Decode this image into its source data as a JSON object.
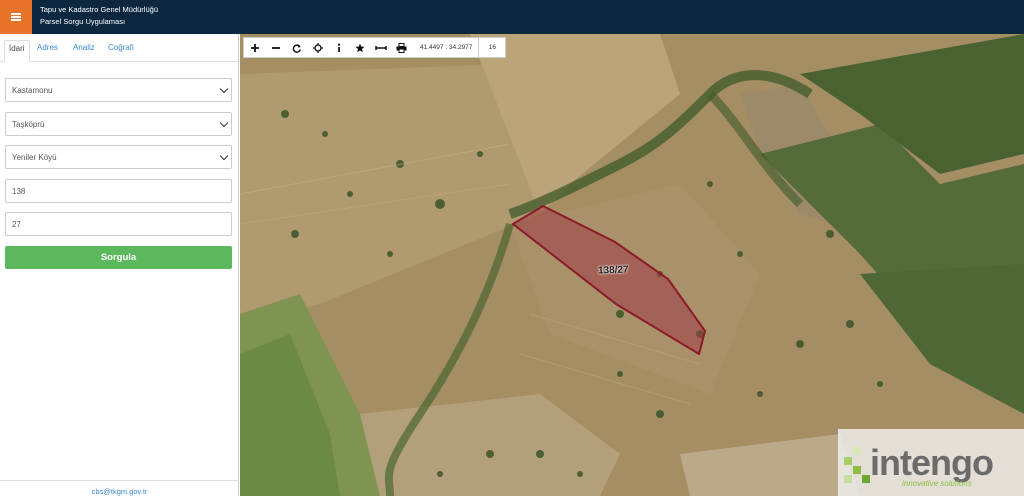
{
  "header": {
    "title_line1": "Tapu ve Kadastro Genel Müdürlüğü",
    "title_line2": "Parsel Sorgu Uygulaması"
  },
  "sidebar": {
    "tabs": [
      {
        "label": "İdari",
        "active": true
      },
      {
        "label": "Adres",
        "active": false
      },
      {
        "label": "Analiz",
        "active": false
      },
      {
        "label": "Coğrafi",
        "active": false
      }
    ],
    "province": "Kastamonu",
    "district": "Taşköprü",
    "neighborhood": "Yeniler Köyü",
    "block_no": "138",
    "parcel_no": "27",
    "query_button": "Sorgula",
    "footer_link": "cbs@tkgm.gov.tr"
  },
  "map": {
    "toolbar": {
      "tools": [
        "zoom-in-icon",
        "zoom-out-icon",
        "refresh-icon",
        "locate-icon",
        "info-icon",
        "star-icon",
        "measure-icon",
        "print-icon"
      ],
      "coordinates": "41.4497 : 34.2977",
      "zoom_level": "16"
    },
    "parcel_label": "138/27",
    "parcel_color": "#8b1a2b",
    "logo_text": "intengo",
    "logo_tagline": "innovative solutions"
  }
}
